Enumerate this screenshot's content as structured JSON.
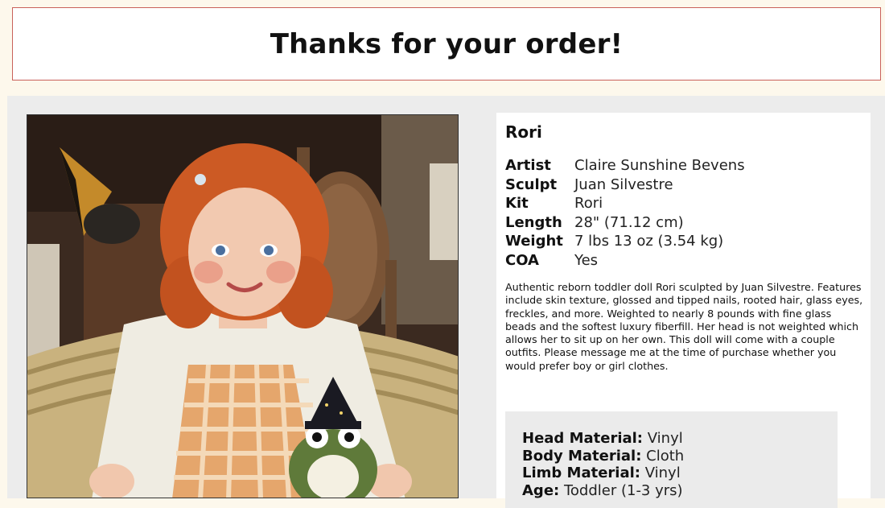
{
  "header": {
    "title": "Thanks for your order!"
  },
  "product": {
    "name": "Rori",
    "image_alt": "Reborn toddler doll with red curly hair holding a frog plush",
    "specs": [
      {
        "label": "Artist",
        "value": "Claire Sunshine Bevens"
      },
      {
        "label": "Sculpt",
        "value": "Juan Silvestre"
      },
      {
        "label": "Kit",
        "value": "Rori"
      },
      {
        "label": "Length",
        "value": "28\" (71.12 cm)"
      },
      {
        "label": "Weight",
        "value": "7 lbs 13 oz (3.54 kg)"
      },
      {
        "label": "COA",
        "value": "Yes"
      }
    ],
    "description": "Authentic reborn toddler doll Rori sculpted by Juan Silvestre. Features include skin texture, glossed and tipped nails, rooted hair, glass eyes, freckles, and more. Weighted to nearly 8 pounds with fine glass beads and the softest luxury fiberfill. Her head is not weighted which allows her to sit up on her own. This doll will come with a couple outfits. Please message me at the time of purchase whether you would prefer boy or girl clothes.",
    "materials": [
      {
        "label": "Head Material:",
        "value": "Vinyl"
      },
      {
        "label": "Body Material:",
        "value": "Cloth"
      },
      {
        "label": "Limb Material:",
        "value": "Vinyl"
      },
      {
        "label": "Age:",
        "value": "Toddler (1-3 yrs)"
      }
    ]
  },
  "colors": {
    "header_border": "#c9615a",
    "page_bg": "#fdf8ec",
    "content_bg": "#ececec"
  }
}
